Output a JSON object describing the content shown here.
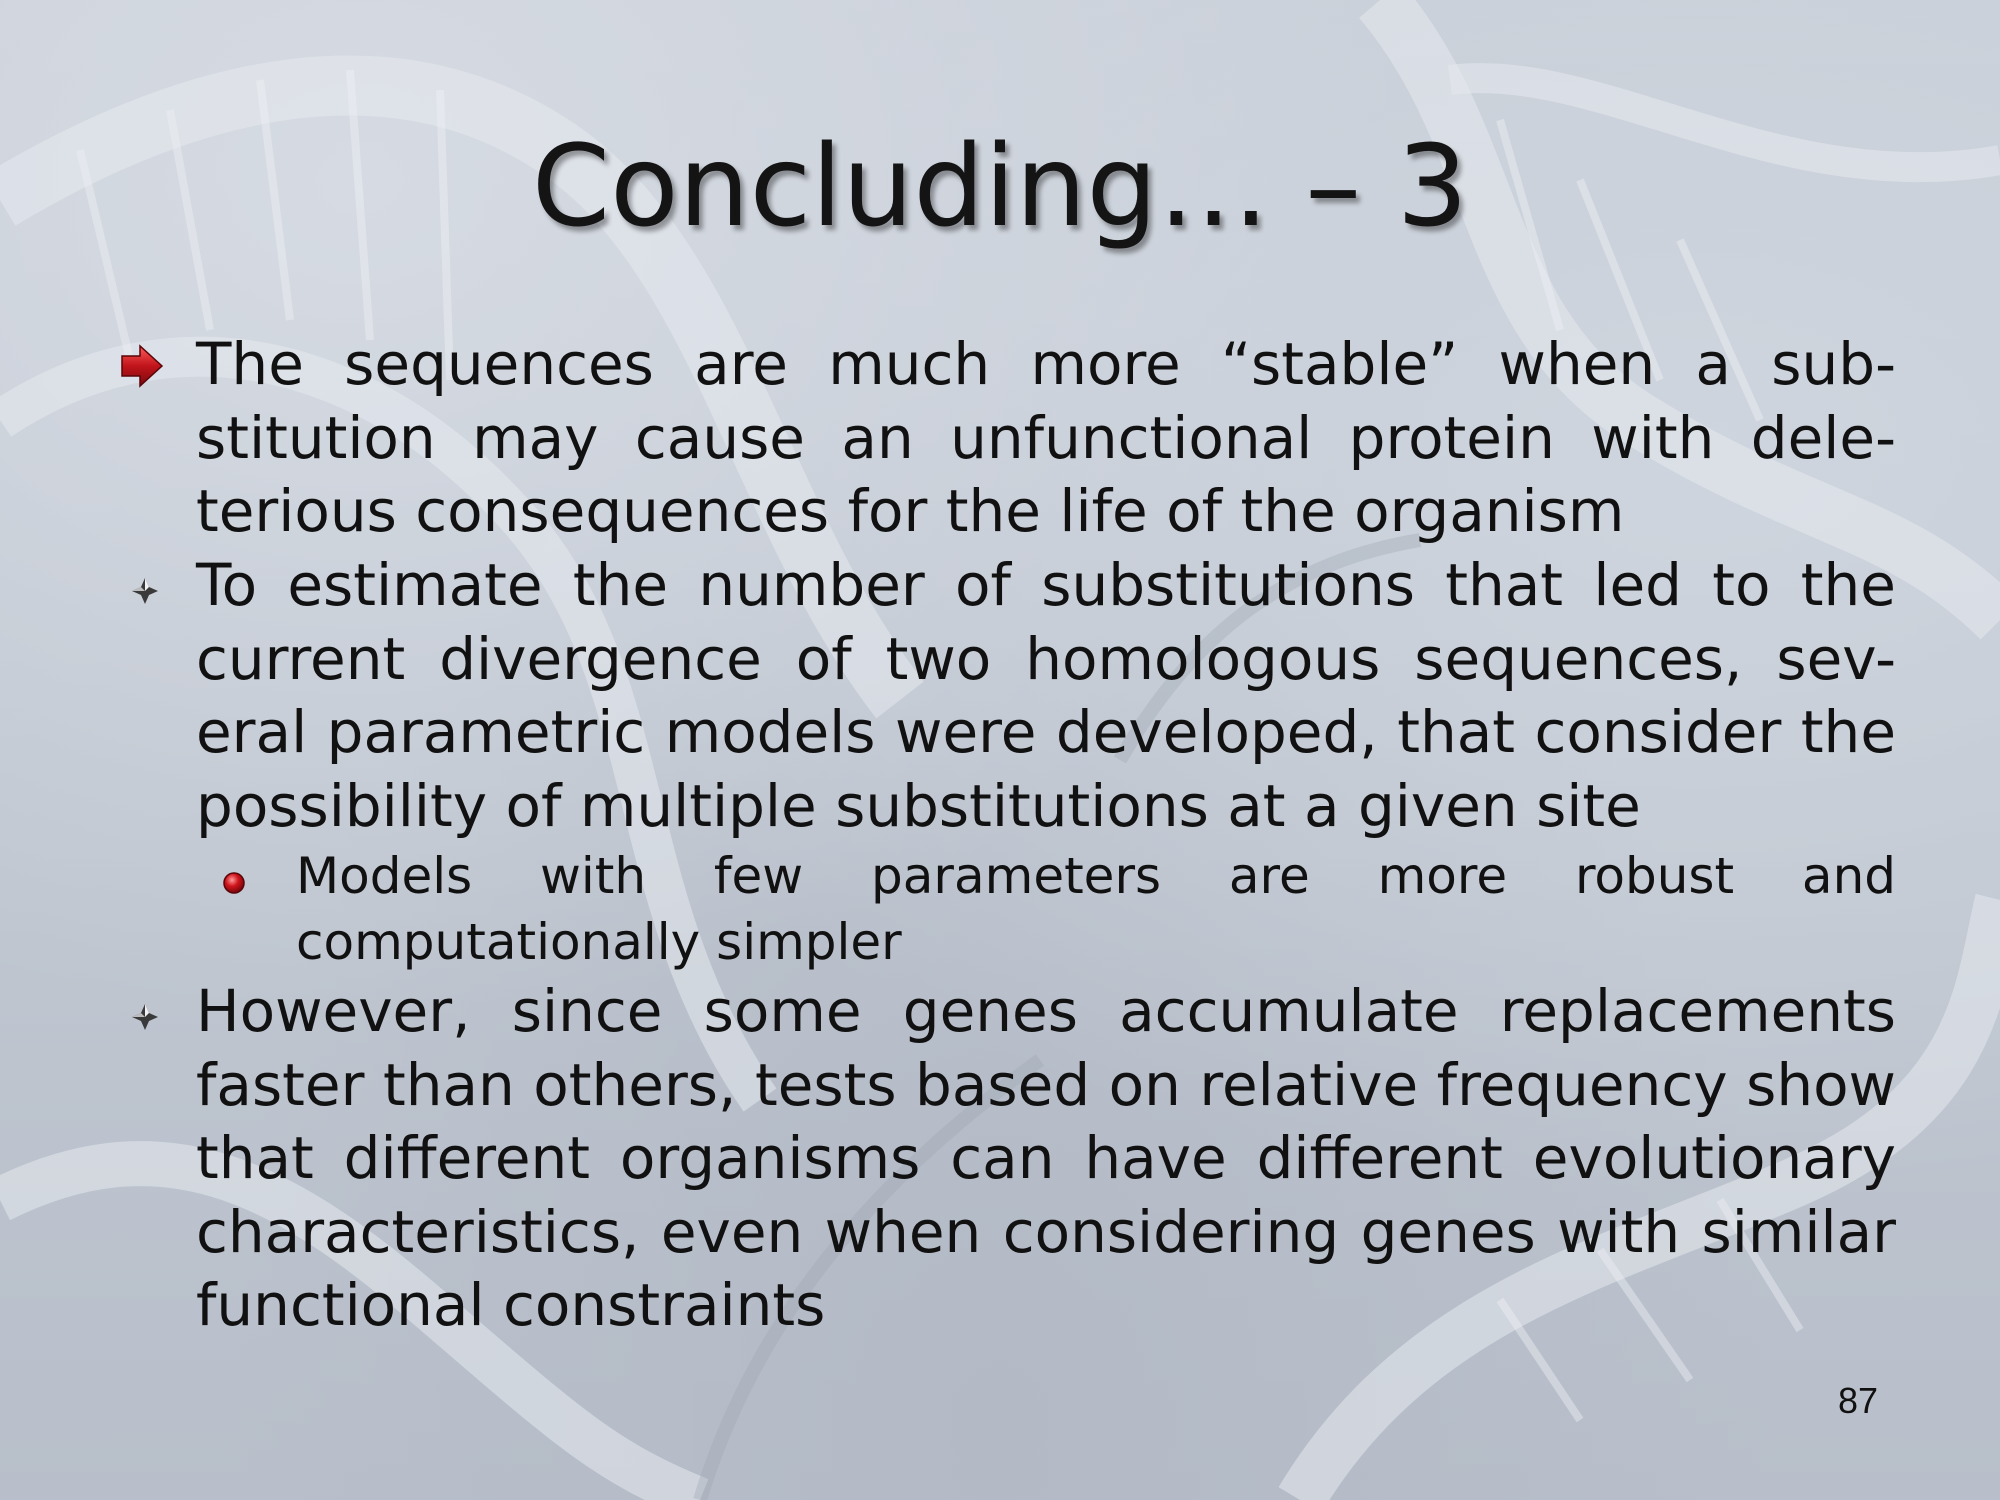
{
  "slide": {
    "title": "Concluding… – 3",
    "page_number": "87",
    "colors": {
      "background": "#c3c9d3",
      "text": "#111111",
      "arrow_bullet": "#c0141a",
      "dot_bullet": "#b01018",
      "diamond_bullet": "#3a3a3a"
    },
    "bullets": [
      {
        "icon": "red-arrow-icon",
        "text": "The sequences are much more “stable” when a sub-stitution may cause an unfunctional protein with dele-terious consequences for the life of the organism"
      },
      {
        "icon": "diamond-bullet-icon",
        "text": "To estimate the number of substitutions that led to the current divergence of two homologous sequences, sev-eral parametric models were developed, that consider the possibility of multiple substitutions at a given site"
      },
      {
        "icon": "red-dot-icon",
        "text": "Models with few parameters are more robust and computationally simpler"
      },
      {
        "icon": "diamond-bullet-icon",
        "text": "However, since some genes accumulate replacements faster than others, tests based on relative frequency show that different organisms can have different evolutionary characteristics, even when considering genes with similar functional constraints"
      }
    ]
  }
}
